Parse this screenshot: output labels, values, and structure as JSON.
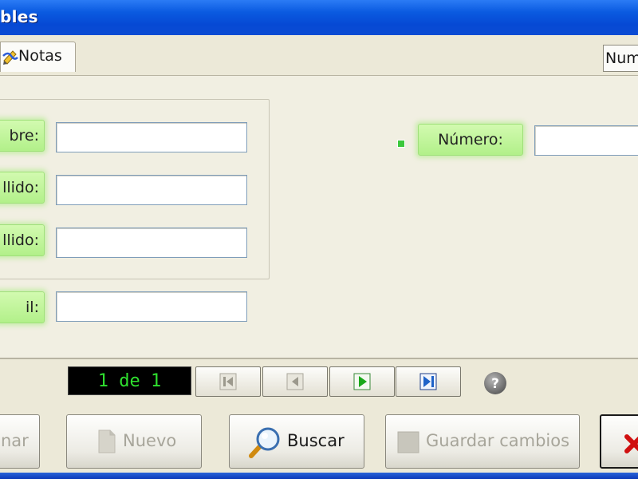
{
  "window": {
    "title": "bles"
  },
  "tabs": [
    {
      "label": "Notas",
      "icon": "notes-icon"
    },
    {
      "label": "Num"
    }
  ],
  "form": {
    "fields_left": [
      {
        "label": "bre:",
        "value": ""
      },
      {
        "label": "llido:",
        "value": ""
      },
      {
        "label": "llido:",
        "value": ""
      },
      {
        "label": "il:",
        "value": ""
      }
    ],
    "field_right": {
      "label": "Número:",
      "value": ""
    }
  },
  "navigator": {
    "counter": "1 de 1",
    "buttons": [
      "first-record-icon",
      "previous-record-icon",
      "next-record-icon",
      "last-record-icon"
    ],
    "help_icon": "help-icon"
  },
  "actions": {
    "delete_label": "nar",
    "new_label": "Nuevo",
    "search_label": "Buscar",
    "save_label": "Guardar cambios",
    "close_icon": "close-icon"
  },
  "colors": {
    "titlebar": "#0a5ae0",
    "label_green": "#b8f290",
    "counter_text": "#2fe02f",
    "play_green": "#18a818",
    "nav_blue": "#1f62c8",
    "close_red": "#d01010"
  }
}
